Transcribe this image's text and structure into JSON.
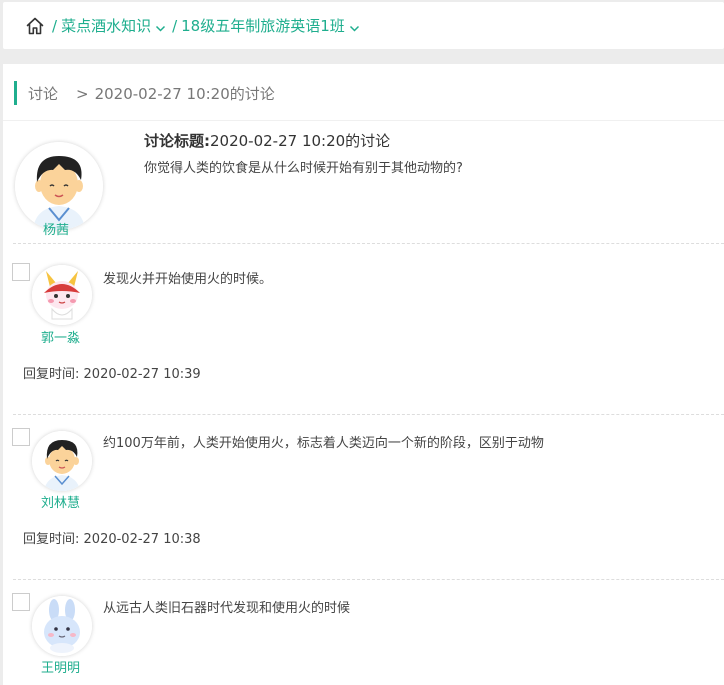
{
  "breadcrumb": {
    "course": "菜点酒水知识",
    "class_name": "18级五年制旅游英语1班",
    "separator": "/"
  },
  "subheader": {
    "section": "讨论",
    "arrow": ">",
    "page": "2020-02-27 10:20的讨论"
  },
  "topic": {
    "author": "杨茜",
    "title_label": "讨论标题:",
    "title": "2020-02-27 10:20的讨论",
    "question": "你觉得人类的饮食是从什么时候开始有别于其他动物的?"
  },
  "replies": [
    {
      "author": "郭一淼",
      "text": "发现火并开始使用火的时候。",
      "time_label": "回复时间:",
      "time": "2020-02-27 10:39"
    },
    {
      "author": "刘林慧",
      "text": "约100万年前，人类开始使用火，标志着人类迈向一个新的阶段，区别于动物",
      "time_label": "回复时间:",
      "time": "2020-02-27 10:38"
    },
    {
      "author": "王明明",
      "text": "从远古人类旧石器时代发现和使用火的时候"
    }
  ],
  "colors": {
    "accent": "#1fae8e"
  }
}
